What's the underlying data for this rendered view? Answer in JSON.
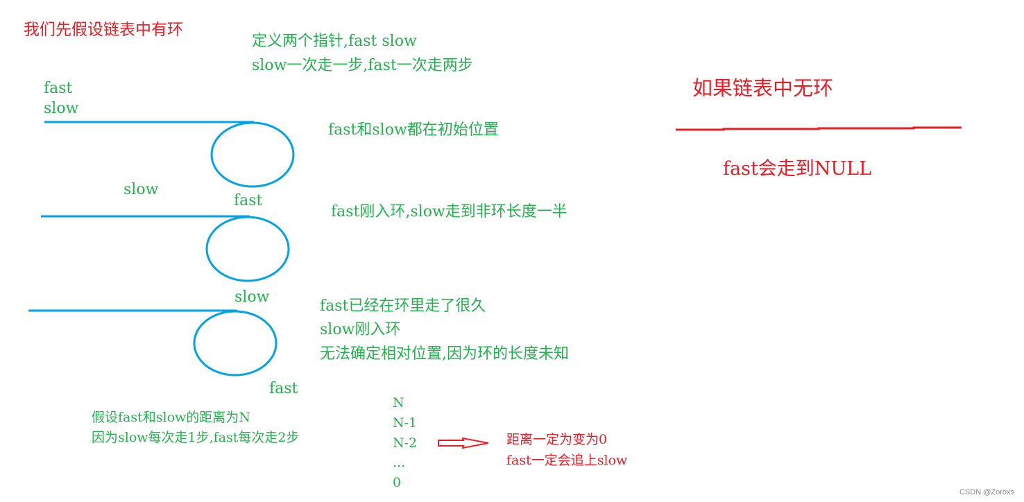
{
  "colors": {
    "text_green": "#22b14c",
    "text_red": "#ed1c24",
    "loop_blue": "#00a2e8",
    "watermark": "#888888"
  },
  "title": "我们先假设链表中有环",
  "definition": {
    "line1": "定义两个指针,fast  slow",
    "line2": "slow一次走一步,fast一次走两步"
  },
  "stages": [
    {
      "labels": {
        "fast": "fast",
        "slow": "slow"
      },
      "description": [
        "fast和slow都在初始位置"
      ]
    },
    {
      "labels": {
        "slow": "slow",
        "fast": "fast"
      },
      "description": [
        "fast刚入环,slow走到非环长度一半"
      ]
    },
    {
      "labels": {
        "slow": "slow",
        "fast": "fast"
      },
      "description": [
        "fast已经在环里走了很久",
        "slow刚入环",
        "无法确定相对位置,因为环的长度未知"
      ]
    }
  ],
  "assumption": {
    "line1": "假设fast和slow的距离为N",
    "line2": "因为slow每次走1步,fast每次走2步"
  },
  "distance_sequence": [
    "N",
    "N-1",
    "N-2",
    "...",
    "0"
  ],
  "conclusion": {
    "arrow_icon": "double-outline-right-arrow",
    "line1": "距离一定为变为0",
    "line2": "fast一定会追上slow"
  },
  "no_cycle": {
    "title": "如果链表中无环",
    "result": "fast会走到NULL"
  },
  "watermark": "CSDN @Zoroxs"
}
